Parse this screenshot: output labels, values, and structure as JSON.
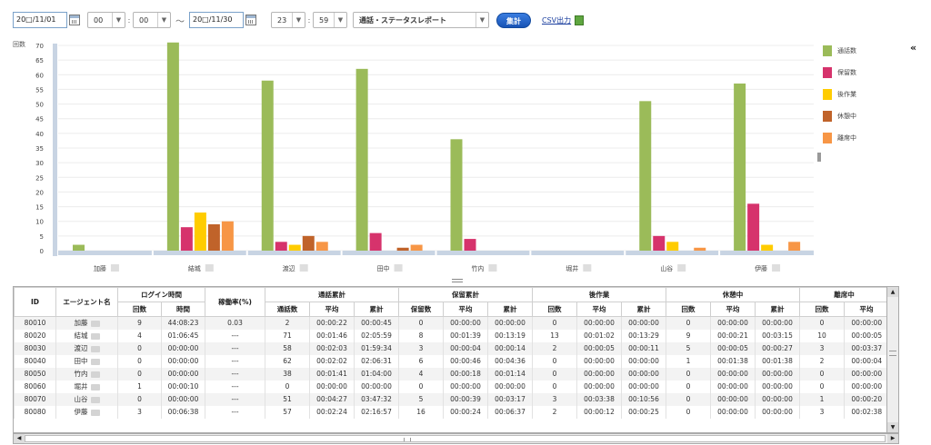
{
  "filters": {
    "start_date": "20□/11/01",
    "start_hour": "00",
    "start_minute": "00",
    "separator": "～",
    "end_date": "20□/11/30",
    "end_hour": "23",
    "end_minute": "59",
    "report_type": "通話・ステータスレポート",
    "colon": ":",
    "submit_label": "集計",
    "csv_label": "CSV出力"
  },
  "chart_data": {
    "type": "bar",
    "ylabel": "回数",
    "ylim": [
      0,
      70
    ],
    "yticks": [
      0,
      5,
      10,
      15,
      20,
      25,
      30,
      35,
      40,
      45,
      50,
      55,
      60,
      65,
      70
    ],
    "categories": [
      "加藤",
      "結城",
      "渡辺",
      "田中",
      "竹内",
      "堀井",
      "山谷",
      "伊藤"
    ],
    "series": [
      {
        "name": "通話数",
        "color": "#9bbb59",
        "values": [
          2,
          71,
          58,
          62,
          38,
          0,
          51,
          57
        ]
      },
      {
        "name": "保留数",
        "color": "#d6336c",
        "values": [
          0,
          8,
          3,
          6,
          4,
          0,
          5,
          16
        ]
      },
      {
        "name": "後作業",
        "color": "#ffcc00",
        "values": [
          0,
          13,
          2,
          0,
          0,
          0,
          3,
          2
        ]
      },
      {
        "name": "休憩中",
        "color": "#c0632a",
        "values": [
          0,
          9,
          5,
          1,
          0,
          0,
          0,
          0
        ]
      },
      {
        "name": "離席中",
        "color": "#f79646",
        "values": [
          0,
          10,
          3,
          2,
          0,
          0,
          1,
          3
        ]
      }
    ],
    "legend": "right",
    "grid": true
  },
  "table": {
    "headers": {
      "id": "ID",
      "agent": "エージェント名",
      "login": "ログイン時間",
      "util": "稼働率(%)",
      "calls": "通話累計",
      "hold": "保留累計",
      "after": "後作業",
      "break": "休憩中",
      "away": "離席中"
    },
    "sub": {
      "count": "回数",
      "time": "時間",
      "call_count": "通話数",
      "avg": "平均",
      "total": "累計",
      "hold_count": "保留数"
    },
    "rows": [
      {
        "id": "80010",
        "name": "加藤",
        "login_count": "9",
        "login_time": "44:08:23",
        "util": "0.03",
        "call_n": "2",
        "call_avg": "00:00:22",
        "call_tot": "00:00:45",
        "hold_n": "0",
        "hold_avg": "00:00:00",
        "hold_tot": "00:00:00",
        "aw_n": "0",
        "aw_avg": "00:00:00",
        "aw_tot": "00:00:00",
        "br_n": "0",
        "br_avg": "00:00:00",
        "br_tot": "00:00:00",
        "aa_n": "0",
        "aa_avg": "00:00:00"
      },
      {
        "id": "80020",
        "name": "結城",
        "login_count": "4",
        "login_time": "01:06:45",
        "util": "---",
        "call_n": "71",
        "call_avg": "00:01:46",
        "call_tot": "02:05:59",
        "hold_n": "8",
        "hold_avg": "00:01:39",
        "hold_tot": "00:13:19",
        "aw_n": "13",
        "aw_avg": "00:01:02",
        "aw_tot": "00:13:29",
        "br_n": "9",
        "br_avg": "00:00:21",
        "br_tot": "00:03:15",
        "aa_n": "10",
        "aa_avg": "00:00:05"
      },
      {
        "id": "80030",
        "name": "渡辺",
        "login_count": "0",
        "login_time": "00:00:00",
        "util": "---",
        "call_n": "58",
        "call_avg": "00:02:03",
        "call_tot": "01:59:34",
        "hold_n": "3",
        "hold_avg": "00:00:04",
        "hold_tot": "00:00:14",
        "aw_n": "2",
        "aw_avg": "00:00:05",
        "aw_tot": "00:00:11",
        "br_n": "5",
        "br_avg": "00:00:05",
        "br_tot": "00:00:27",
        "aa_n": "3",
        "aa_avg": "00:03:37"
      },
      {
        "id": "80040",
        "name": "田中",
        "login_count": "0",
        "login_time": "00:00:00",
        "util": "---",
        "call_n": "62",
        "call_avg": "00:02:02",
        "call_tot": "02:06:31",
        "hold_n": "6",
        "hold_avg": "00:00:46",
        "hold_tot": "00:04:36",
        "aw_n": "0",
        "aw_avg": "00:00:00",
        "aw_tot": "00:00:00",
        "br_n": "1",
        "br_avg": "00:01:38",
        "br_tot": "00:01:38",
        "aa_n": "2",
        "aa_avg": "00:00:04"
      },
      {
        "id": "80050",
        "name": "竹内",
        "login_count": "0",
        "login_time": "00:00:00",
        "util": "---",
        "call_n": "38",
        "call_avg": "00:01:41",
        "call_tot": "01:04:00",
        "hold_n": "4",
        "hold_avg": "00:00:18",
        "hold_tot": "00:01:14",
        "aw_n": "0",
        "aw_avg": "00:00:00",
        "aw_tot": "00:00:00",
        "br_n": "0",
        "br_avg": "00:00:00",
        "br_tot": "00:00:00",
        "aa_n": "0",
        "aa_avg": "00:00:00"
      },
      {
        "id": "80060",
        "name": "堀井",
        "login_count": "1",
        "login_time": "00:00:10",
        "util": "---",
        "call_n": "0",
        "call_avg": "00:00:00",
        "call_tot": "00:00:00",
        "hold_n": "0",
        "hold_avg": "00:00:00",
        "hold_tot": "00:00:00",
        "aw_n": "0",
        "aw_avg": "00:00:00",
        "aw_tot": "00:00:00",
        "br_n": "0",
        "br_avg": "00:00:00",
        "br_tot": "00:00:00",
        "aa_n": "0",
        "aa_avg": "00:00:00"
      },
      {
        "id": "80070",
        "name": "山谷",
        "login_count": "0",
        "login_time": "00:00:00",
        "util": "---",
        "call_n": "51",
        "call_avg": "00:04:27",
        "call_tot": "03:47:32",
        "hold_n": "5",
        "hold_avg": "00:00:39",
        "hold_tot": "00:03:17",
        "aw_n": "3",
        "aw_avg": "00:03:38",
        "aw_tot": "00:10:56",
        "br_n": "0",
        "br_avg": "00:00:00",
        "br_tot": "00:00:00",
        "aa_n": "1",
        "aa_avg": "00:00:20"
      },
      {
        "id": "80080",
        "name": "伊藤",
        "login_count": "3",
        "login_time": "00:06:38",
        "util": "---",
        "call_n": "57",
        "call_avg": "00:02:24",
        "call_tot": "02:16:57",
        "hold_n": "16",
        "hold_avg": "00:00:24",
        "hold_tot": "00:06:37",
        "aw_n": "2",
        "aw_avg": "00:00:12",
        "aw_tot": "00:00:25",
        "br_n": "0",
        "br_avg": "00:00:00",
        "br_tot": "00:00:00",
        "aa_n": "3",
        "aa_avg": "00:02:38"
      }
    ]
  }
}
